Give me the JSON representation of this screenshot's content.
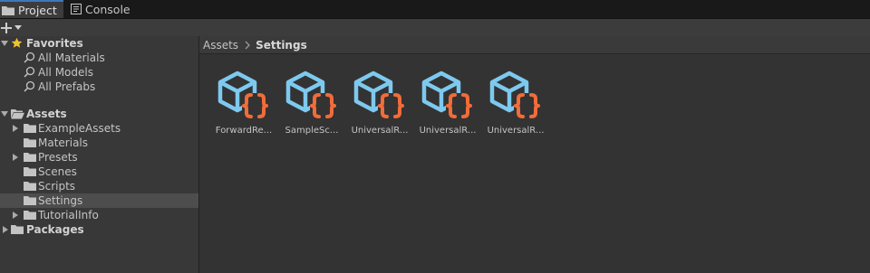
{
  "tabs": [
    {
      "label": "Project",
      "icon": "folder-icon",
      "active": true
    },
    {
      "label": "Console",
      "icon": "console-icon",
      "active": false
    }
  ],
  "toolbar": {
    "add_icon": "plus-icon",
    "dropdown_icon": "chevron-down-icon"
  },
  "favorites": {
    "label": "Favorites",
    "items": [
      {
        "label": "All Materials",
        "icon": "search-icon"
      },
      {
        "label": "All Models",
        "icon": "search-icon"
      },
      {
        "label": "All Prefabs",
        "icon": "search-icon"
      }
    ]
  },
  "assets_tree": {
    "label": "Assets",
    "children": [
      {
        "label": "ExampleAssets",
        "has_children": true
      },
      {
        "label": "Materials",
        "has_children": false
      },
      {
        "label": "Presets",
        "has_children": true
      },
      {
        "label": "Scenes",
        "has_children": false
      },
      {
        "label": "Scripts",
        "has_children": false
      },
      {
        "label": "Settings",
        "has_children": false,
        "selected": true
      },
      {
        "label": "TutorialInfo",
        "has_children": true
      }
    ]
  },
  "packages": {
    "label": "Packages"
  },
  "breadcrumb": {
    "root": "Assets",
    "current": "Settings"
  },
  "asset_items": [
    {
      "label": "ForwardRe...",
      "icon": "scriptable-object-icon"
    },
    {
      "label": "SampleSc...",
      "icon": "scriptable-object-icon"
    },
    {
      "label": "UniversalR...",
      "icon": "scriptable-object-icon"
    },
    {
      "label": "UniversalR...",
      "icon": "scriptable-object-icon"
    },
    {
      "label": "UniversalR...",
      "icon": "scriptable-object-icon"
    }
  ],
  "colors": {
    "cube": "#7dc9ef",
    "braces": "#f16c3a",
    "star": "#f0c430",
    "selection": "#4d4d4d"
  }
}
